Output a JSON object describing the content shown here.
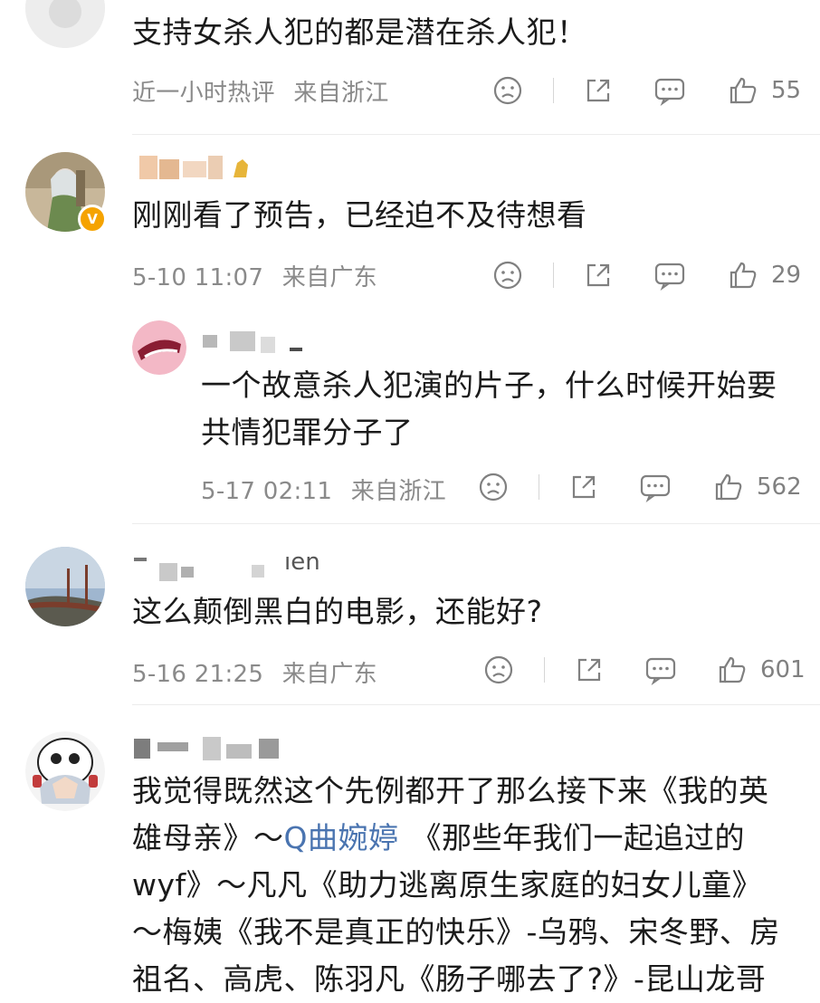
{
  "comments": [
    {
      "text": "支持女杀人犯的都是潜在杀人犯！",
      "time": "近一小时热评",
      "location": "来自浙江",
      "likes": "55"
    },
    {
      "text": "刚刚看了预告，已经迫不及待想看",
      "time": "5-10 11:07",
      "location": "来自广东",
      "likes": "29"
    },
    {
      "text_line1": "一个故意杀人犯演的片子，什么时候开始要",
      "text_line2": "共情犯罪分子了",
      "time": "5-17 02:11",
      "location": "来自浙江",
      "likes": "562"
    },
    {
      "name_fragment": "ıen",
      "text": "这么颠倒黑白的电影，还能好?",
      "time": "5-16 21:25",
      "location": "来自广东",
      "likes": "601"
    },
    {
      "line1": "我觉得既然这个先例都开了那么接下来《我的英",
      "line2a": "雄母亲》～",
      "mention": "Q曲婉婷",
      "line2b": "《那些年我们一起追过的",
      "line3": "wyf》～凡凡《助力逃离原生家庭的妇女儿童》",
      "line4": "～梅姨《我不是真正的快乐》-乌鸦、宋冬野、房",
      "line5": "祖名、高虎、陈羽凡《肠子哪去了?》-昆山龙哥"
    }
  ],
  "icons": [
    "dislike-icon",
    "share-icon",
    "reply-icon",
    "like-icon",
    "verified-badge-icon"
  ],
  "colors": {
    "text": "#1b1b1b",
    "meta": "#8a8a8a",
    "mention": "#4a74b0",
    "badge": "#f5a300"
  }
}
